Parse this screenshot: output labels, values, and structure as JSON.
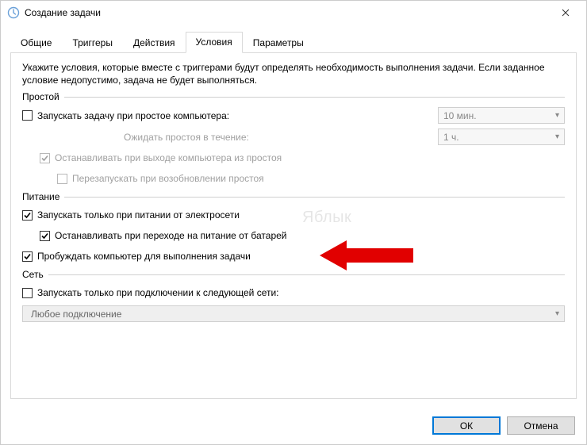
{
  "window": {
    "title": "Создание задачи"
  },
  "tabs": [
    {
      "id": "general",
      "label": "Общие",
      "active": false
    },
    {
      "id": "triggers",
      "label": "Триггеры",
      "active": false
    },
    {
      "id": "actions",
      "label": "Действия",
      "active": false
    },
    {
      "id": "conditions",
      "label": "Условия",
      "active": true
    },
    {
      "id": "settings",
      "label": "Параметры",
      "active": false
    }
  ],
  "description": "Укажите условия, которые вместе с триггерами будут определять необходимость выполнения задачи. Если заданное условие недопустимо, задача не будет выполняться.",
  "groups": {
    "idle": {
      "label": "Простой"
    },
    "power": {
      "label": "Питание"
    },
    "network": {
      "label": "Сеть"
    }
  },
  "idle": {
    "start_if_idle": {
      "label": "Запускать задачу при простое компьютера:",
      "checked": false,
      "enabled": true
    },
    "idle_duration": {
      "value": "10 мин.",
      "enabled": false
    },
    "wait_label": "Ожидать простоя в течение:",
    "wait_duration": {
      "value": "1 ч.",
      "enabled": false
    },
    "stop_on_end": {
      "label": "Останавливать при выходе компьютера из простоя",
      "checked": true,
      "enabled": false
    },
    "restart_on_idle": {
      "label": "Перезапускать при возобновлении простоя",
      "checked": false,
      "enabled": false
    }
  },
  "power": {
    "start_on_ac": {
      "label": "Запускать только при питании от электросети",
      "checked": true,
      "enabled": true
    },
    "stop_on_batt": {
      "label": "Останавливать при переходе на питание от батарей",
      "checked": true,
      "enabled": true
    },
    "wake_to_run": {
      "label": "Пробуждать компьютер для выполнения задачи",
      "checked": true,
      "enabled": true
    }
  },
  "network": {
    "start_on_net": {
      "label": "Запускать только при подключении к следующей сети:",
      "checked": false,
      "enabled": true
    },
    "net_select": {
      "value": "Любое подключение",
      "enabled": false
    }
  },
  "buttons": {
    "ok": "ОК",
    "cancel": "Отмена"
  },
  "watermark": "Яблык"
}
